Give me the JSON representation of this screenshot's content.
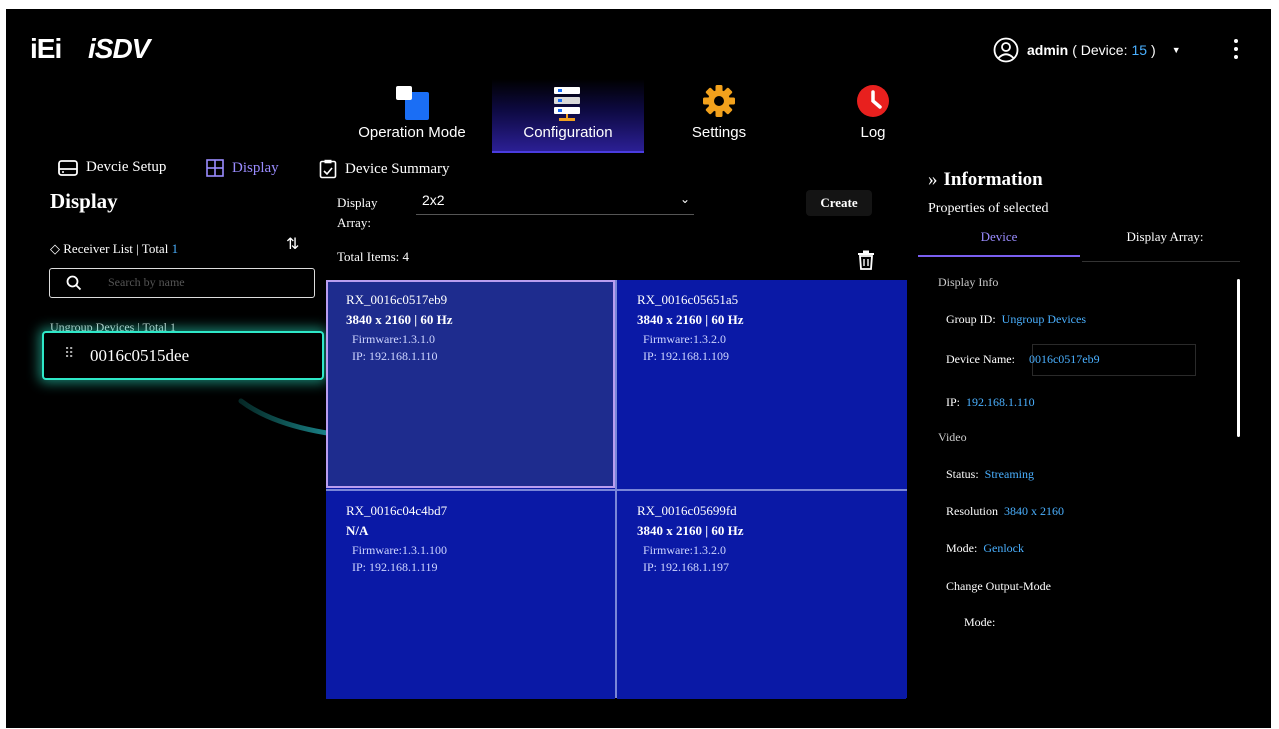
{
  "brand": {
    "logo_left": "iEi",
    "logo_right": "iSDV"
  },
  "user": {
    "name": "admin",
    "device_prefix": "( Device:",
    "device_count": "15",
    "device_suffix": ")",
    "caret": "▼"
  },
  "nav": [
    {
      "label": "Operation Mode"
    },
    {
      "label": "Configuration"
    },
    {
      "label": "Settings"
    },
    {
      "label": "Log"
    }
  ],
  "subtabs": [
    {
      "label": "Devcie Setup"
    },
    {
      "label": "Display"
    },
    {
      "label": "Device Summary"
    }
  ],
  "left": {
    "title": "Display",
    "receiver_label": "Receiver List | Total",
    "receiver_total": "1",
    "search_placeholder": "Search by name",
    "ungroup_label": "Ungroup Devices | Total 1",
    "device": "0016c0515dee"
  },
  "center": {
    "display_array_label": "Display Array:",
    "selected_array": "2x2",
    "create_label": "Create",
    "total_items": "Total Items: 4",
    "cells": [
      {
        "name": "RX_0016c0517eb9",
        "res": "3840 x 2160 | 60 Hz",
        "fw": "Firmware:1.3.1.0",
        "ip": "IP: 192.168.1.110"
      },
      {
        "name": "RX_0016c05651a5",
        "res": "3840 x 2160 | 60 Hz",
        "fw": "Firmware:1.3.2.0",
        "ip": "IP: 192.168.1.109"
      },
      {
        "name": "RX_0016c04c4bd7",
        "res": "N/A",
        "fw": "Firmware:1.3.1.100",
        "ip": "IP: 192.168.1.119"
      },
      {
        "name": "RX_0016c05699fd",
        "res": "3840 x 2160 | 60 Hz",
        "fw": "Firmware:1.3.2.0",
        "ip": "IP: 192.168.1.197"
      }
    ]
  },
  "info": {
    "title": "Information",
    "subtitle": "Properties of selected",
    "tab_device": "Device",
    "tab_array": "Display Array:",
    "section_display": "Display Info",
    "group_label": "Group ID:",
    "group_value": "Ungroup Devices",
    "name_label": "Device Name:",
    "name_value": "0016c0517eb9",
    "ip_label": "IP:",
    "ip_value": "192.168.1.110",
    "section_video": "Video",
    "status_label": "Status:",
    "status_value": "Streaming",
    "res_label": "Resolution",
    "res_value": "3840 x 2160",
    "mode_label": "Mode:",
    "mode_value": "Genlock",
    "change_label": "Change Output-Mode",
    "mode2_label": "Mode:"
  },
  "colors": {
    "accent": "#4ab0ff",
    "highlight": "#2ee8c8",
    "grid": "#0a19a6",
    "tab_active": "#9a8cff"
  }
}
